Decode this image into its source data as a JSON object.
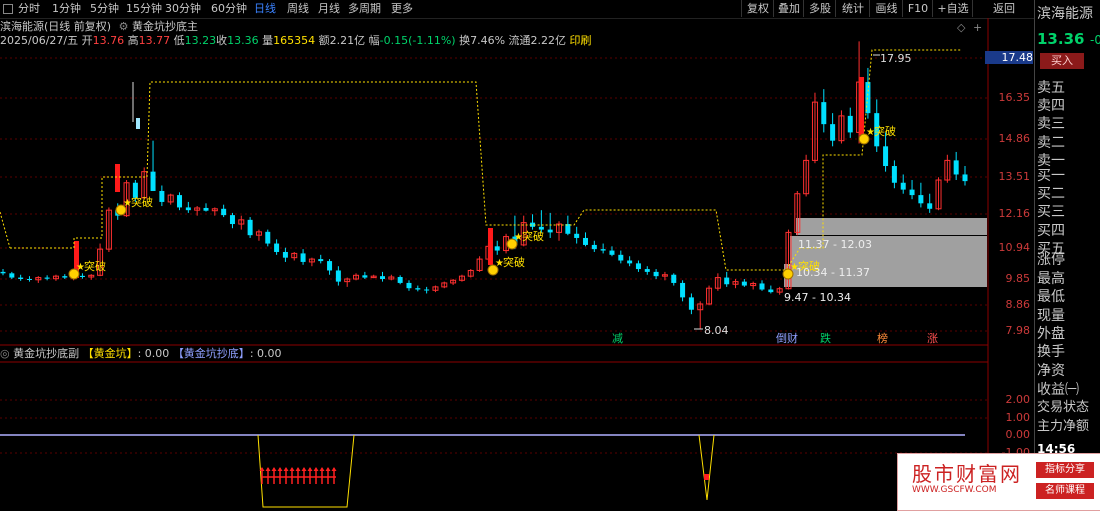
{
  "toolbar": {
    "tabs": [
      "分时",
      "1分钟",
      "5分钟",
      "15分钟",
      "30分钟",
      "60分钟",
      "日线",
      "周线",
      "月线",
      "多周期",
      "更多"
    ],
    "active": "日线",
    "right_tabs": [
      "复权",
      "叠加",
      "多股",
      "统计",
      "画线",
      "F10",
      "+自选",
      "返回"
    ]
  },
  "info": {
    "title": "滨海能源(日线 前复权)",
    "indicator": "黄金坑抄底主",
    "date": "2025/06/27/五",
    "open_label": "开",
    "open": "13.76",
    "high_label": "高",
    "high": "13.77",
    "low_label": "低",
    "low": "13.23",
    "close_label": "收",
    "close": "13.36",
    "vol_label": "量",
    "vol": "165354",
    "amt_label": "额",
    "amt": "2.21亿",
    "chg_label": "幅",
    "chg": "-0.15(-1.11%)",
    "turn_label": "换",
    "turn": "7.46%",
    "float_label": "流通",
    "float": "2.22亿",
    "print": "印刷"
  },
  "panel": {
    "name": "滨海能源",
    "price": "13.36",
    "dash": "-0",
    "buy": "买入",
    "rows": [
      "卖五",
      "卖四",
      "卖三",
      "卖二",
      "卖一",
      "买一",
      "买二",
      "买三",
      "买四",
      "买五",
      "涨停",
      "最高",
      "最低",
      "现量",
      "外盘",
      "换手",
      "净资",
      "收益㈠",
      "交易状态",
      "主力净额"
    ],
    "time": "14:56"
  },
  "yaxis": [
    "17.48",
    "16.35",
    "14.86",
    "13.51",
    "12.16",
    "10.94",
    "9.85",
    "8.86",
    "7.98"
  ],
  "sub": {
    "name": "黄金坑抄底副",
    "a_label": "【黄金坑】",
    "a_val": ": 0.00",
    "b_label": "【黄金坑抄底】",
    "b_val": ": 0.00",
    "yaxis": [
      "2.00",
      "1.00",
      "0.00",
      "-1.00"
    ]
  },
  "annotations": {
    "breakout": "突破",
    "high_mark": "17.95",
    "low_mark": "8.04",
    "zones": [
      "11.37 - 12.03",
      "10.34 - 11.37",
      "9.47 - 10.34"
    ],
    "tags": [
      "减",
      "倒财",
      "跌",
      "榜",
      "涨"
    ]
  },
  "colors": {
    "up": "#ff3030",
    "down": "#00e0ff",
    "yellow": "#ffe000"
  },
  "watermark": {
    "name": "股市财富网",
    "url": "WWW.GSCFW.COM",
    "b1": "指标分享",
    "b2": "名师课程"
  },
  "candles": [
    [
      10.1,
      10.2,
      9.98,
      10.05
    ],
    [
      10.05,
      10.1,
      9.85,
      9.9
    ],
    [
      9.9,
      10.0,
      9.78,
      9.85
    ],
    [
      9.85,
      9.95,
      9.75,
      9.82
    ],
    [
      9.82,
      9.95,
      9.7,
      9.9
    ],
    [
      9.9,
      9.98,
      9.8,
      9.86
    ],
    [
      9.86,
      10.0,
      9.78,
      9.95
    ],
    [
      9.95,
      10.02,
      9.85,
      9.9
    ],
    [
      9.9,
      10.0,
      9.8,
      9.96
    ],
    [
      9.96,
      10.05,
      9.86,
      9.92
    ],
    [
      9.92,
      10.02,
      9.82,
      9.98
    ],
    [
      9.98,
      11.1,
      9.95,
      10.9
    ],
    [
      10.9,
      12.4,
      10.8,
      12.3
    ],
    [
      12.3,
      12.55,
      11.95,
      12.1
    ],
    [
      12.1,
      13.4,
      12.05,
      13.3
    ],
    [
      13.3,
      13.4,
      12.6,
      12.75
    ],
    [
      12.75,
      13.85,
      12.7,
      13.7
    ],
    [
      13.7,
      14.8,
      13.6,
      13.0
    ],
    [
      13.0,
      13.2,
      12.45,
      12.6
    ],
    [
      12.6,
      12.9,
      12.5,
      12.85
    ],
    [
      12.85,
      12.95,
      12.3,
      12.4
    ],
    [
      12.4,
      12.6,
      12.2,
      12.3
    ],
    [
      12.3,
      12.45,
      12.1,
      12.38
    ],
    [
      12.38,
      12.55,
      12.25,
      12.28
    ],
    [
      12.28,
      12.4,
      12.1,
      12.35
    ],
    [
      12.35,
      12.5,
      12.05,
      12.12
    ],
    [
      12.12,
      12.2,
      11.65,
      11.8
    ],
    [
      11.8,
      12.1,
      11.6,
      11.95
    ],
    [
      11.95,
      12.05,
      11.3,
      11.4
    ],
    [
      11.4,
      11.6,
      11.2,
      11.52
    ],
    [
      11.52,
      11.6,
      11.0,
      11.1
    ],
    [
      11.1,
      11.25,
      10.7,
      10.8
    ],
    [
      10.8,
      10.95,
      10.45,
      10.6
    ],
    [
      10.6,
      10.8,
      10.5,
      10.75
    ],
    [
      10.75,
      10.9,
      10.35,
      10.45
    ],
    [
      10.45,
      10.6,
      10.3,
      10.55
    ],
    [
      10.55,
      10.7,
      10.4,
      10.48
    ],
    [
      10.48,
      10.55,
      10.0,
      10.15
    ],
    [
      10.15,
      10.3,
      9.6,
      9.75
    ],
    [
      9.75,
      9.9,
      9.55,
      9.85
    ],
    [
      9.85,
      10.05,
      9.8,
      9.98
    ],
    [
      9.98,
      10.1,
      9.85,
      9.9
    ],
    [
      9.9,
      10.0,
      9.88,
      9.95
    ],
    [
      9.95,
      10.1,
      9.75,
      9.85
    ],
    [
      9.85,
      10.0,
      9.8,
      9.92
    ],
    [
      9.92,
      9.98,
      9.65,
      9.7
    ],
    [
      9.7,
      9.8,
      9.4,
      9.5
    ],
    [
      9.5,
      9.6,
      9.38,
      9.45
    ],
    [
      9.45,
      9.55,
      9.3,
      9.42
    ],
    [
      9.42,
      9.6,
      9.35,
      9.55
    ],
    [
      9.55,
      9.75,
      9.5,
      9.7
    ],
    [
      9.7,
      9.85,
      9.62,
      9.8
    ],
    [
      9.8,
      10.0,
      9.75,
      9.95
    ],
    [
      9.95,
      10.2,
      9.9,
      10.15
    ],
    [
      10.15,
      10.65,
      10.1,
      10.55
    ],
    [
      10.55,
      11.1,
      10.5,
      11.0
    ],
    [
      11.0,
      11.2,
      10.7,
      10.85
    ],
    [
      10.85,
      11.45,
      10.75,
      11.35
    ],
    [
      11.35,
      12.1,
      10.9,
      11.05
    ],
    [
      11.05,
      12.1,
      11.0,
      11.85
    ],
    [
      11.85,
      12.15,
      11.6,
      11.7
    ],
    [
      11.7,
      12.3,
      11.5,
      11.6
    ],
    [
      11.6,
      12.2,
      11.3,
      11.5
    ],
    [
      11.5,
      11.9,
      11.2,
      11.8
    ],
    [
      11.8,
      12.1,
      11.4,
      11.45
    ],
    [
      11.45,
      11.7,
      11.1,
      11.3
    ],
    [
      11.3,
      11.5,
      11.0,
      11.05
    ],
    [
      11.05,
      11.2,
      10.8,
      10.9
    ],
    [
      10.9,
      11.1,
      10.75,
      10.85
    ],
    [
      10.85,
      11.0,
      10.65,
      10.7
    ],
    [
      10.7,
      10.85,
      10.4,
      10.5
    ],
    [
      10.5,
      10.65,
      10.3,
      10.4
    ],
    [
      10.4,
      10.5,
      10.1,
      10.2
    ],
    [
      10.2,
      10.3,
      10.0,
      10.1
    ],
    [
      10.1,
      10.2,
      9.85,
      9.95
    ],
    [
      9.95,
      10.1,
      9.8,
      10.0
    ],
    [
      10.0,
      10.05,
      9.6,
      9.7
    ],
    [
      9.7,
      9.8,
      9.0,
      9.15
    ],
    [
      9.15,
      9.3,
      8.55,
      8.7
    ],
    [
      8.7,
      9.0,
      8.04,
      8.9
    ],
    [
      8.9,
      9.6,
      8.85,
      9.5
    ],
    [
      9.5,
      10.05,
      9.4,
      9.9
    ],
    [
      9.9,
      10.1,
      9.55,
      9.65
    ],
    [
      9.65,
      9.85,
      9.5,
      9.75
    ],
    [
      9.75,
      9.85,
      9.55,
      9.6
    ],
    [
      9.6,
      9.75,
      9.45,
      9.68
    ],
    [
      9.68,
      9.8,
      9.4,
      9.45
    ],
    [
      9.45,
      9.6,
      9.3,
      9.35
    ],
    [
      9.35,
      9.55,
      9.25,
      9.48
    ],
    [
      9.48,
      11.6,
      9.45,
      11.5
    ],
    [
      11.5,
      13.0,
      11.4,
      12.9
    ],
    [
      12.9,
      14.3,
      12.8,
      14.1
    ],
    [
      14.1,
      16.5,
      14.0,
      16.2
    ],
    [
      16.2,
      16.6,
      15.1,
      15.4
    ],
    [
      15.4,
      15.8,
      14.6,
      14.8
    ],
    [
      14.8,
      15.9,
      14.7,
      15.7
    ],
    [
      15.7,
      16.0,
      14.9,
      15.1
    ],
    [
      15.1,
      17.95,
      14.7,
      16.8
    ],
    [
      16.8,
      17.2,
      15.6,
      15.8
    ],
    [
      15.8,
      16.3,
      14.4,
      14.6
    ],
    [
      14.6,
      15.1,
      13.7,
      13.9
    ],
    [
      13.9,
      14.1,
      13.1,
      13.3
    ],
    [
      13.3,
      13.6,
      12.9,
      13.05
    ],
    [
      13.05,
      13.4,
      12.7,
      12.85
    ],
    [
      12.85,
      13.3,
      12.4,
      12.55
    ],
    [
      12.55,
      12.9,
      12.2,
      12.35
    ],
    [
      12.35,
      13.5,
      12.3,
      13.4
    ],
    [
      13.4,
      14.3,
      13.3,
      14.1
    ],
    [
      14.1,
      14.4,
      13.4,
      13.6
    ],
    [
      13.6,
      13.9,
      13.2,
      13.36
    ]
  ]
}
